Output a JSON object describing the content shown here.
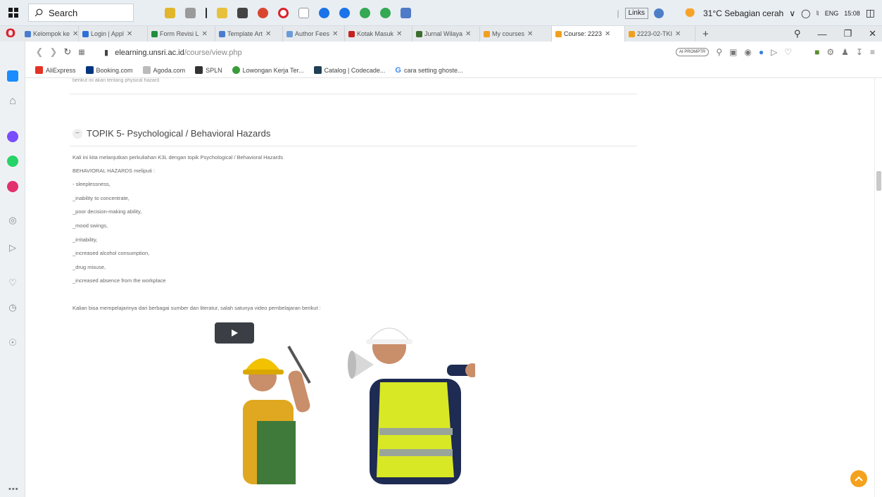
{
  "taskbar": {
    "search_label": "Search",
    "links_label": "Links",
    "weather": "31°C  Sebagian cerah",
    "language": "ENG",
    "time": "15:08"
  },
  "browser": {
    "tabs": [
      {
        "label": "Kelompok ke",
        "color": "#4a7bd0"
      },
      {
        "label": "Login | Appl",
        "color": "#2f6fd6"
      },
      {
        "label": "Form Revisi L",
        "color": "#1e8e3e"
      },
      {
        "label": "Template Art",
        "color": "#4a7bd0"
      },
      {
        "label": "Author Fees",
        "color": "#6a9bd8"
      },
      {
        "label": "Kotak Masuk",
        "color": "#c5221f"
      },
      {
        "label": "Jurnal Wilaya",
        "color": "#3c6e2f"
      },
      {
        "label": "My courses",
        "color": "#f0a020"
      },
      {
        "label": "Course: 2223",
        "color": "#f0a020"
      },
      {
        "label": "2223-02-TKI",
        "color": "#f0a020"
      }
    ],
    "new_tab": "+",
    "url_domain": "elearning.unsri.ac.id",
    "url_path": "/course/view.php",
    "ext_pill": "AI PROMPTR",
    "bookmarks": [
      {
        "label": "AliExpress",
        "color": "#e43225"
      },
      {
        "label": "Booking.com",
        "color": "#003580"
      },
      {
        "label": "Agoda.com",
        "color": "#7a7a7a"
      },
      {
        "label": "SPLN",
        "color": "#333333"
      },
      {
        "label": "Lowongan Kerja Ter...",
        "color": "#3a9b3a"
      },
      {
        "label": "Catalog | Codecade...",
        "color": "#1f4056"
      },
      {
        "label": "cara setting ghoste...",
        "color": "#4285f4"
      }
    ]
  },
  "page": {
    "prev_section_text": "berikut ini akan tentang physical hazard",
    "topic_title": "TOPIK 5- Psychological / Behavioral Hazards",
    "intro": "Kali ini kita melanjutkan perkuliahan K3L dengan topik Psychological / Behavioral Hazards",
    "heading": "BEHAVIORAL HAZARDS meliputi :",
    "items": [
      "- sleeplessness,",
      "_inability to concentrate,",
      "_poor decision-making ability,",
      "_mood swings,",
      "_irritability,",
      "_increased alcohol consumption,",
      "_drug misuse,",
      "_increased absence from the workplace"
    ],
    "video_intro": "Kalian bisa mempelajarinya dari berbagai sumber dan literatur, salah satunya video pembelajaran berikut :"
  },
  "colors": {
    "accent": "#f4a11d",
    "opera_red": "#d9232e"
  }
}
